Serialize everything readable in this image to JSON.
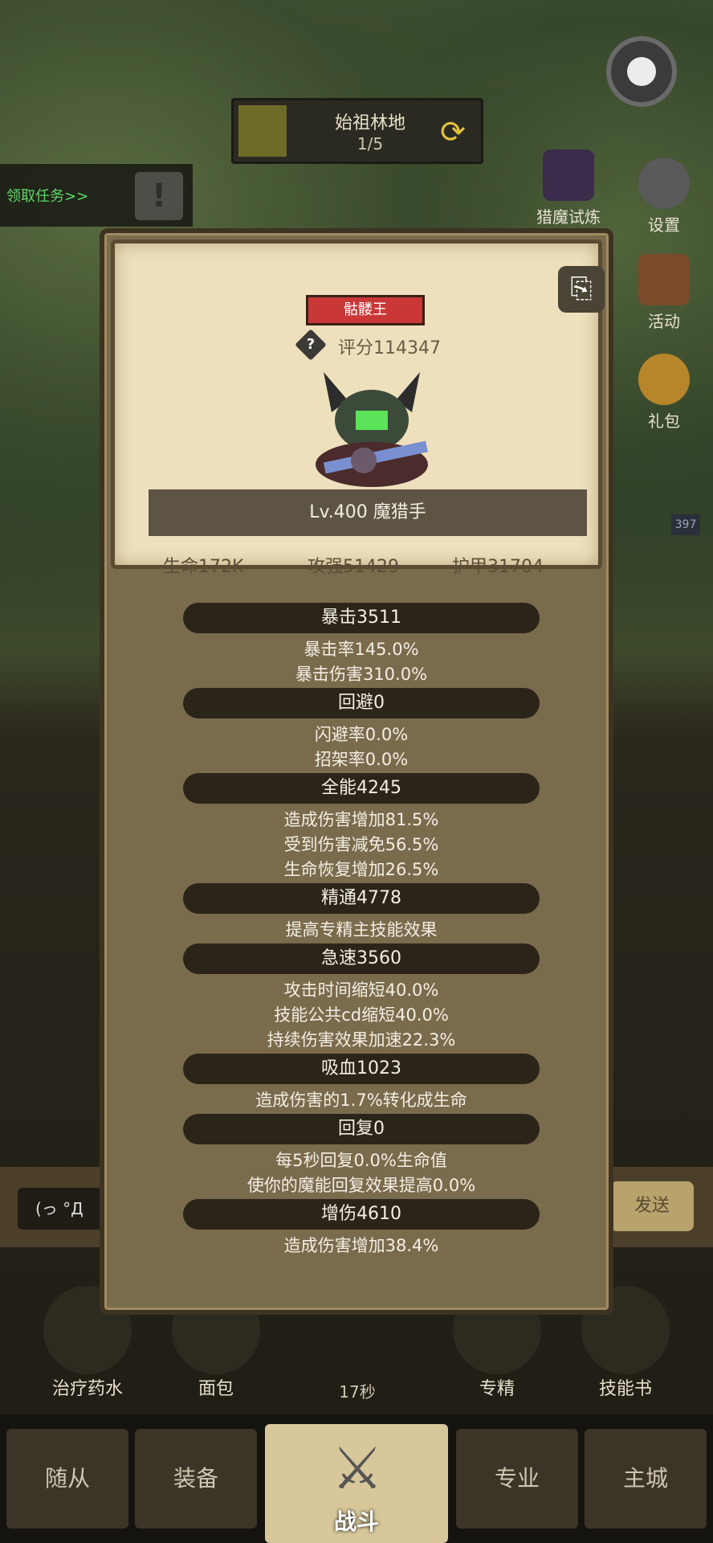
{
  "top": {
    "zone_name": "始祖林地",
    "zone_progress": "1/5",
    "quest_link": "领取任务>>"
  },
  "side_menu": [
    {
      "label": "猎魔试炼",
      "icon": "demon-hunt-icon"
    },
    {
      "label": "设置",
      "icon": "gear-icon"
    },
    {
      "label": "活动",
      "icon": "event-icon"
    },
    {
      "label": "礼包",
      "icon": "gift-pack-icon"
    }
  ],
  "dialog": {
    "name": "骷髅王",
    "score": "评分114347",
    "level_class": "Lv.400 魔猎手",
    "hp": "生命172K",
    "atk": "攻强51429",
    "armor": "护甲31704",
    "sections": [
      {
        "title": "暴击3511",
        "lines": [
          "暴击率145.0%",
          "暴击伤害310.0%"
        ]
      },
      {
        "title": "回避0",
        "lines": [
          "闪避率0.0%",
          "招架率0.0%"
        ]
      },
      {
        "title": "全能4245",
        "lines": [
          "造成伤害增加81.5%",
          "受到伤害减免56.5%",
          "生命恢复增加26.5%"
        ]
      },
      {
        "title": "精通4778",
        "lines": [
          "提高专精主技能效果"
        ]
      },
      {
        "title": "急速3560",
        "lines": [
          "攻击时间缩短40.0%",
          "技能公共cd缩短40.0%",
          "持续伤害效果加速22.3%"
        ]
      },
      {
        "title": "吸血1023",
        "lines": [
          "造成伤害的1.7%转化成生命"
        ]
      },
      {
        "title": "回复0",
        "lines": [
          "每5秒回复0.0%生命值",
          "使你的魔能回复效果提高0.0%"
        ]
      },
      {
        "title": "增伤4610",
        "lines": [
          "造成伤害增加38.4%"
        ]
      }
    ]
  },
  "chat": {
    "input": "(っ °Д",
    "send": "发送"
  },
  "items": [
    "治疗药水",
    "面包",
    "专精",
    "技能书"
  ],
  "timer": "17秒",
  "nav": {
    "tabs": [
      "随从",
      "装备",
      "专业",
      "主城"
    ],
    "battle": "战斗"
  },
  "side_badge": "397"
}
